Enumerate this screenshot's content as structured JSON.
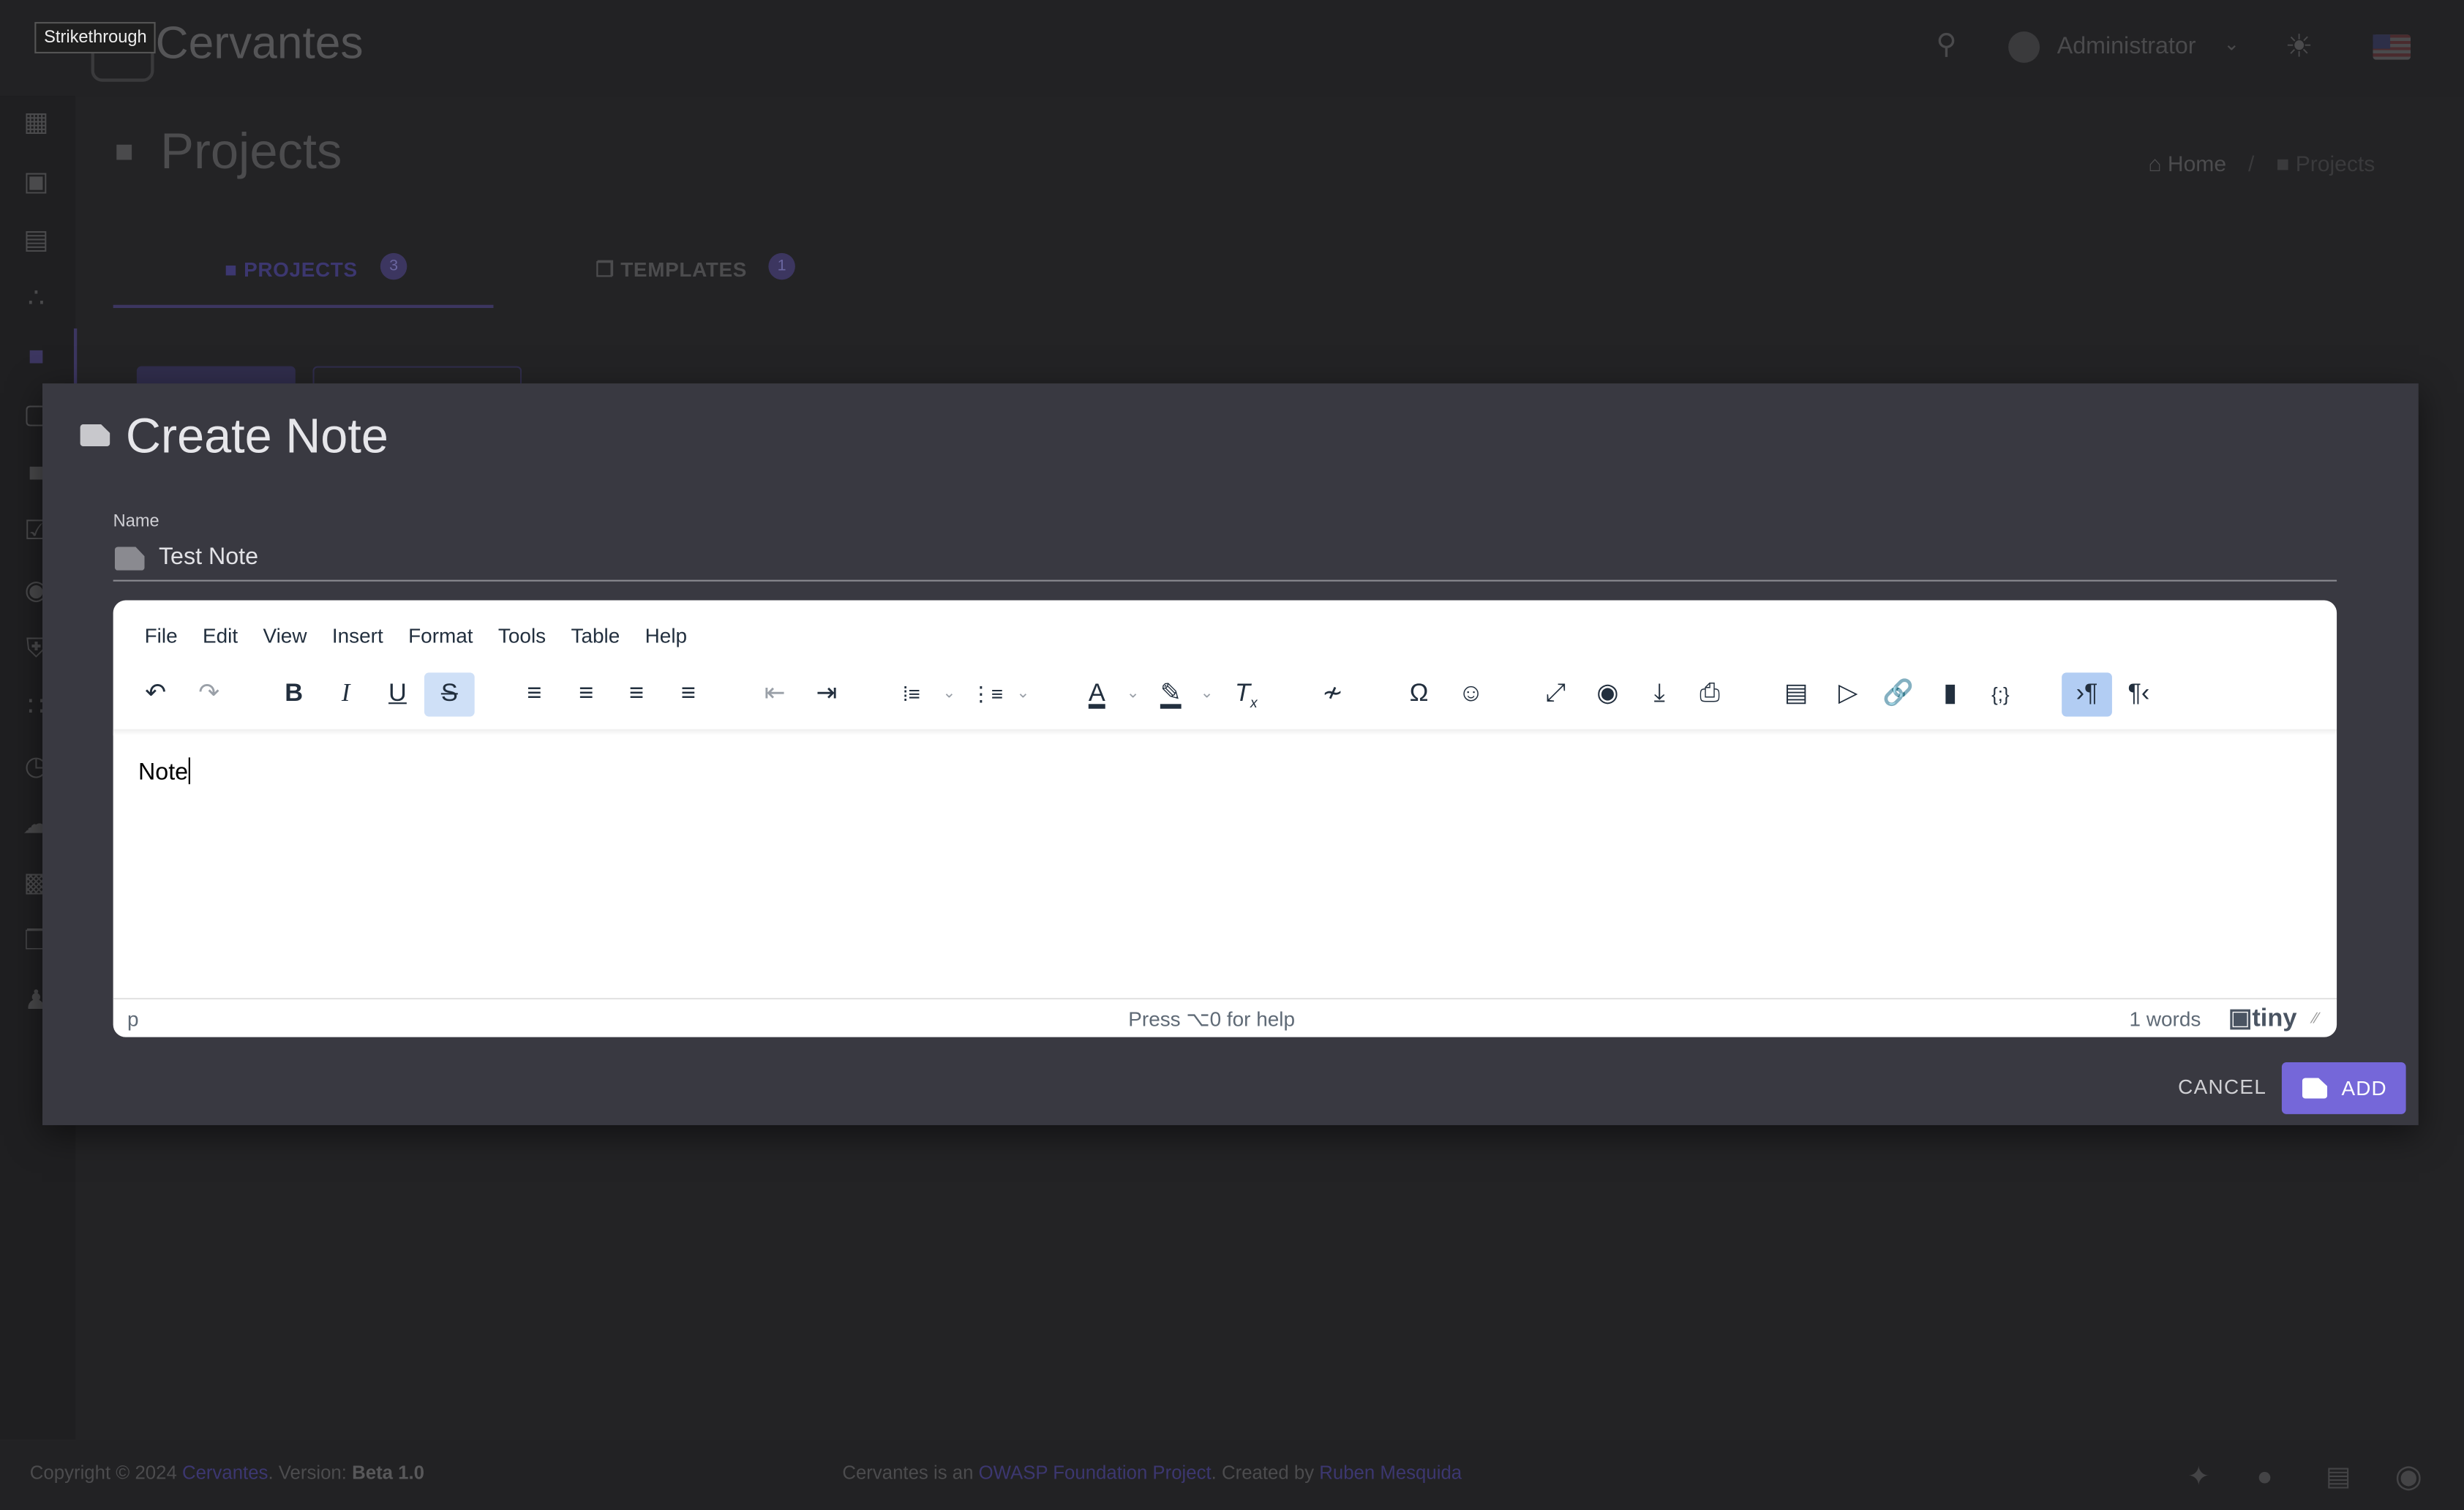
{
  "tooltip": "Strikethrough",
  "app": {
    "title": "Cervantes"
  },
  "header": {
    "user": "Administrator",
    "icons": [
      "search-icon",
      "user-avatar",
      "chevron-down-icon",
      "sun-icon",
      "us-flag-icon"
    ]
  },
  "sidebar": {
    "icons": [
      "dashboard-icon",
      "calendar-icon",
      "book-icon",
      "clients-icon",
      "folder-icon",
      "briefcase-icon",
      "document-icon",
      "task-icon",
      "bug-icon",
      "shield-icon",
      "grid-icon",
      "clock-icon",
      "upload-icon",
      "contact-icon",
      "library-icon",
      "users-icon"
    ],
    "active": "folder-icon"
  },
  "page": {
    "title": "Projects",
    "breadcrumb": [
      "Home",
      "/",
      "Projects"
    ]
  },
  "tabs": [
    {
      "label": "PROJECTS",
      "count": "3",
      "active": true
    },
    {
      "label": "TEMPLATES",
      "count": "1",
      "active": false
    }
  ],
  "modal": {
    "title": "Create Note",
    "name_label": "Name",
    "name_value": "Test Note",
    "editor": {
      "menu": [
        "File",
        "Edit",
        "View",
        "Insert",
        "Format",
        "Tools",
        "Table",
        "Help"
      ],
      "content": "Note",
      "status_path": "p",
      "help_text": "Press ⌥0 for help",
      "word_count": "1 words",
      "brand": "tiny",
      "active_buttons": [
        "strikethrough",
        "ltr"
      ]
    },
    "cancel_label": "CANCEL",
    "add_label": "ADD"
  },
  "footer": {
    "copyright": "Copyright © 2024 ",
    "brand_link": "Cervantes",
    "version_label": ". Version: ",
    "version": "Beta 1.0",
    "middle_prefix": "Cervantes is an ",
    "owasp_link": "OWASP Foundation Project",
    "created_by": ". Created by ",
    "author_link": "Ruben Mesquida",
    "social_icons": [
      "twitter-icon",
      "discord-icon",
      "docs-icon",
      "github-icon"
    ]
  },
  "colors": {
    "accent": "#7567d9",
    "modal_bg": "#393941",
    "page_bg": "#232325",
    "active_button": "#cfe0f7"
  }
}
